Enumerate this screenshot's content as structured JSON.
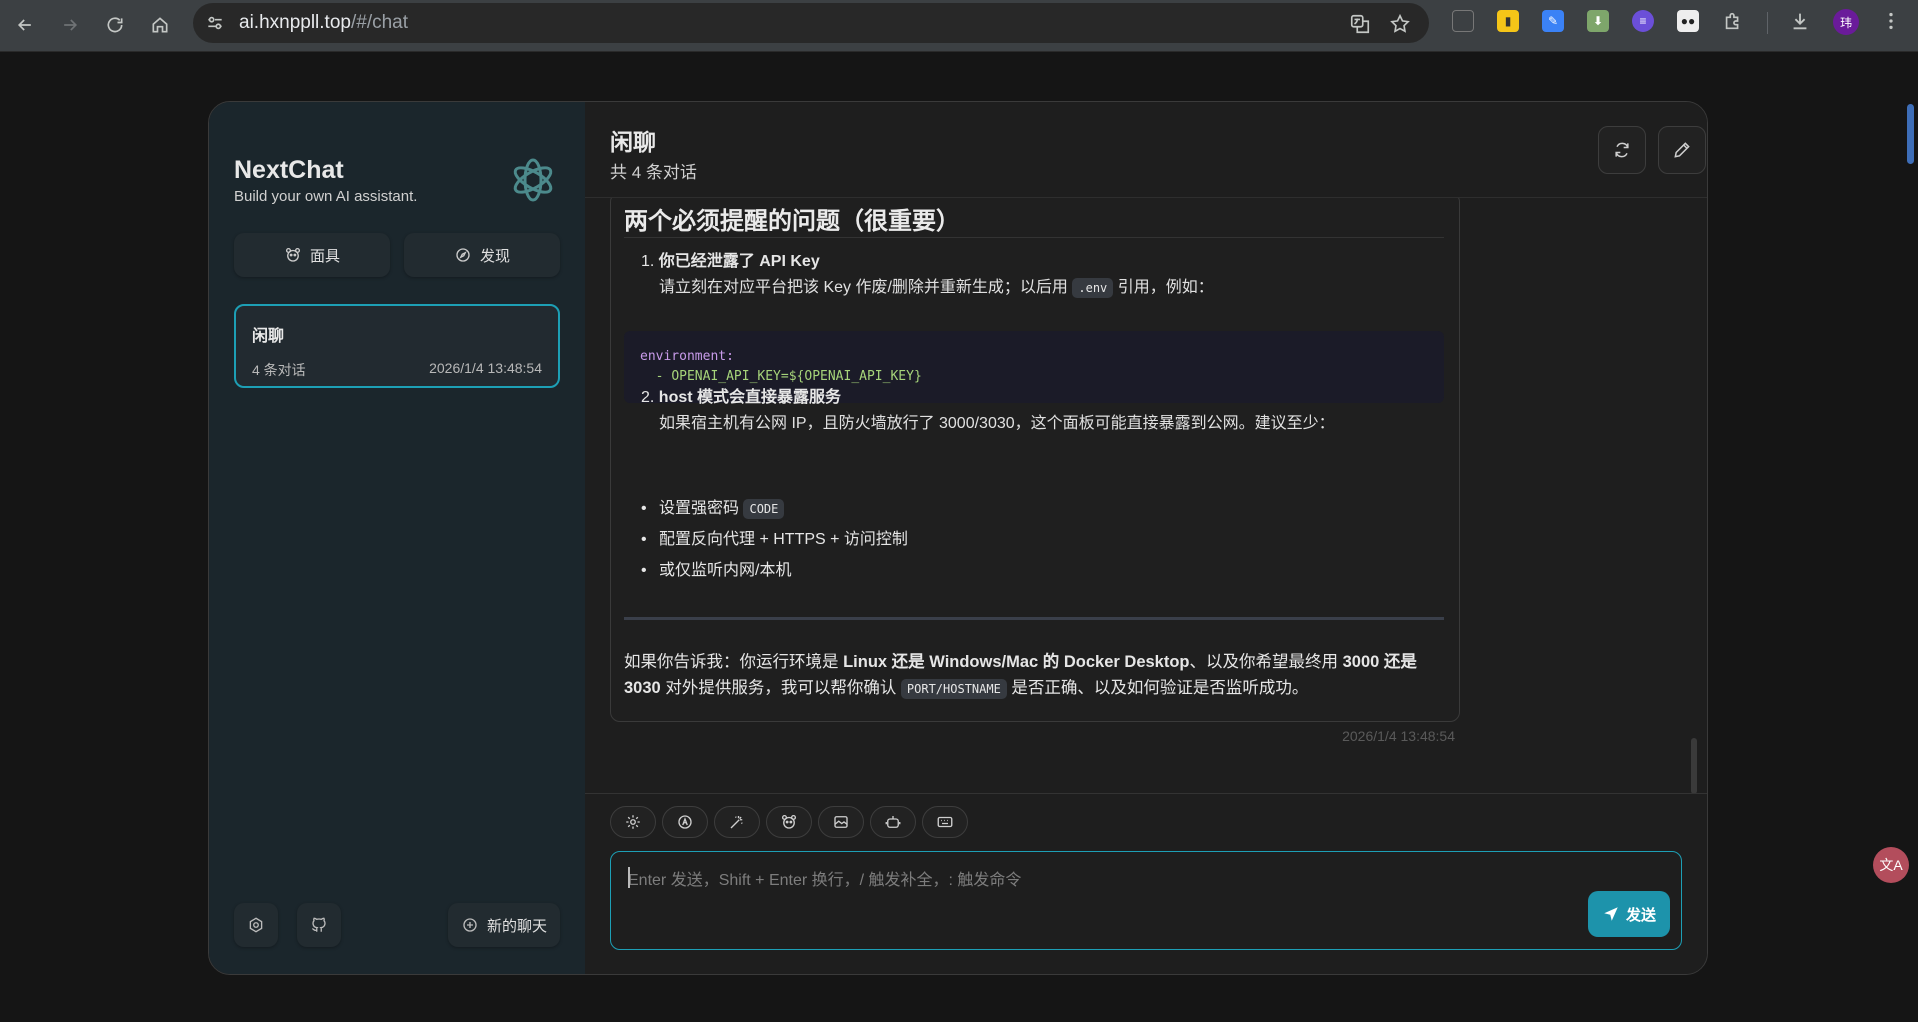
{
  "browser": {
    "url_host": "ai.hxnppll.top",
    "url_path": "/#/chat",
    "avatar_text": "玮"
  },
  "sidebar": {
    "title": "NextChat",
    "subtitle": "Build your own AI assistant.",
    "tabs": [
      {
        "label": "面具",
        "icon": "mask-icon"
      },
      {
        "label": "发现",
        "icon": "compass-icon"
      }
    ],
    "chats": [
      {
        "title": "闲聊",
        "count": "4 条对话",
        "time": "2026/1/4 13:48:54"
      }
    ],
    "new_chat_label": "新的聊天"
  },
  "header": {
    "title": "闲聊",
    "subtitle": "共 4 条对话"
  },
  "message": {
    "heading": "两个必须提醒的问题（很重要）",
    "item1_title": "你已经泄露了 API Key",
    "item1_desc_pre": "请立刻在对应平台把该 Key 作废/删除并重新生成；以后用",
    "item1_code": ".env",
    "item1_desc_post": "引用，例如：",
    "code_line1": "environment:",
    "code_line2_prefix": "  - ",
    "code_line2": "OPENAI_API_KEY=${OPENAI_API_KEY}",
    "item2_title": "host 模式会直接暴露服务",
    "item2_desc": "如果宿主机有公网 IP，且防火墙放行了 3000/3030，这个面板可能直接暴露到公网。建议至少：",
    "bullets": [
      {
        "text": "设置强密码",
        "code": "CODE"
      },
      {
        "text": "配置反向代理 + HTTPS + 访问控制",
        "code": ""
      },
      {
        "text": "或仅监听内网/本机",
        "code": ""
      }
    ],
    "para_1": "如果你告诉我：你运行环境是",
    "para_b1": "Linux 还是 Windows/Mac 的 Docker Desktop",
    "para_2": "、以及你希望最终用",
    "para_b2": "3000 还是 3030",
    "para_3": "对外提供服务，我可以帮你确认",
    "para_code": "PORT/HOSTNAME",
    "para_4": "是否正确、以及如何验证是否监听成功。",
    "timestamp": "2026/1/4 13:48:54"
  },
  "input": {
    "placeholder": "Enter 发送，Shift + Enter 换行，/ 触发补全，: 触发命令",
    "send_label": "发送"
  }
}
